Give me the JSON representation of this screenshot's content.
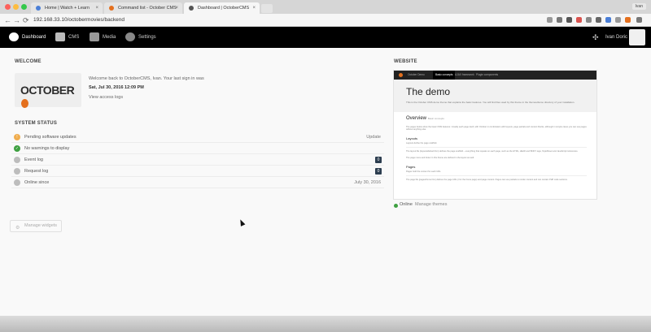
{
  "browser": {
    "tabs": [
      {
        "label": "Home | Watch + Learn",
        "favicon_color": "#4a7ed6"
      },
      {
        "label": "Command list - October CMS",
        "favicon_color": "#e4701e"
      },
      {
        "label": "Dashboard | OctoberCMS",
        "favicon_color": "#555555",
        "active": true
      }
    ],
    "user_chip": "Ivan",
    "url": "192.168.33.10/octobermovies/backend",
    "nav_icons": {
      "back": "←",
      "forward": "→",
      "reload": "⟳"
    }
  },
  "app_nav": {
    "items": [
      {
        "label": "Dashboard",
        "icon": "dashboard-icon",
        "active": true
      },
      {
        "label": "CMS",
        "icon": "cms-icon"
      },
      {
        "label": "Media",
        "icon": "media-icon"
      },
      {
        "label": "Settings",
        "icon": "settings-icon"
      }
    ],
    "gear_glyph": "✣",
    "user_name": "Ivan Doric"
  },
  "welcome": {
    "title": "WELCOME",
    "logo_text": "OCTOBER",
    "message": "Welcome back to OctoberCMS, Ivan. Your last sign in was",
    "date": "Sat, Jul 30, 2016 12:09 PM",
    "access_logs_link": "View access logs"
  },
  "system_status": {
    "title": "SYSTEM STATUS",
    "rows": [
      {
        "label": "Pending software updates",
        "value": "Update",
        "color": "#f0ad4e",
        "glyph": "!"
      },
      {
        "label": "No warnings to display",
        "value": "",
        "color": "#3fa142",
        "glyph": "✓"
      },
      {
        "label": "Event log",
        "badge": "0",
        "color": "#bdbdbd",
        "glyph": ""
      },
      {
        "label": "Request log",
        "badge": "0",
        "color": "#bdbdbd",
        "glyph": ""
      },
      {
        "label": "Online since",
        "value": "July 30, 2016",
        "color": "#bdbdbd",
        "glyph": ""
      }
    ]
  },
  "website": {
    "title": "WEBSITE",
    "preview": {
      "brand": "October Demo",
      "nav": [
        "Basic concepts",
        "AJAX framework",
        "Plugin components"
      ],
      "heading": "The demo",
      "intro": "This is the October CMS demo theme that explains the basic features. You will find files used by this theme in the themes/demo directory of your installation.",
      "overview": "Overview",
      "overview_small": "Basic concepts",
      "overview_text": "The pages below show the basic CMS features. Usually each page itself, with October in combination with layouts, page partials and content blocks, although in simple cases you can use pages without anything else.",
      "layouts": "Layouts",
      "layouts_sub": "Layouts define the page scaffold.",
      "layouts_text": "The layout file (layouts/default.htm) defines the page scaffold -- everything that repeats on each page, such as the HTML, HEAD and BODY tags, StyleSheet and JavaScript references.",
      "layouts_text2": "The page menu and footer in this theme are defined in the layout as well.",
      "pages": "Pages",
      "pages_sub": "Pages hold the content for each URL.",
      "pages_text": "The page file (pages/home.htm) defines the page URL (/ for the home page) and page content. Pages can use partials to render content and can contain PHP code sections."
    },
    "status": "Online",
    "manage_themes": "Manage themes"
  },
  "manage_widgets": "Manage widgets",
  "colors": {
    "accent": "#e4701e",
    "nav_bg": "#000000",
    "online": "#3fa142"
  }
}
